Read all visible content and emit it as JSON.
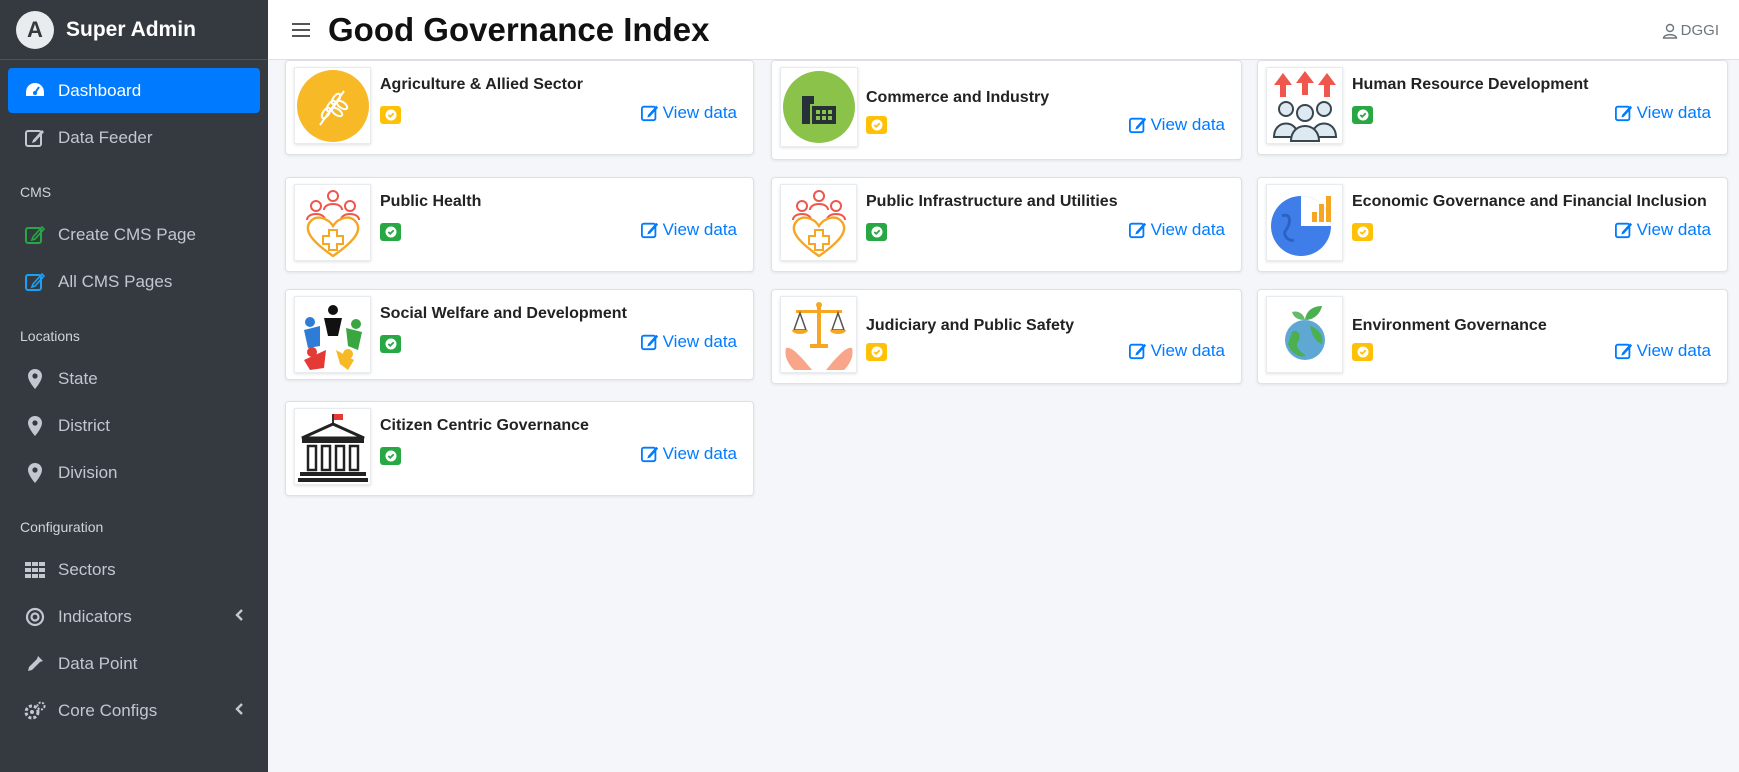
{
  "sidebar": {
    "brand": "Super Admin",
    "items": {
      "dashboard": "Dashboard",
      "data_feeder": "Data Feeder",
      "cms_header": "CMS",
      "create_cms": "Create CMS Page",
      "all_cms": "All CMS Pages",
      "locations_header": "Locations",
      "state": "State",
      "district": "District",
      "division": "Division",
      "config_header": "Configuration",
      "sectors": "Sectors",
      "indicators": "Indicators",
      "data_point": "Data Point",
      "core_configs": "Core Configs"
    }
  },
  "header": {
    "title": "Good Governance Index",
    "user": "DGGI"
  },
  "colors": {
    "accent": "#007bff",
    "sidebar": "#343a40",
    "status_green": "#28a745",
    "status_yellow": "#ffc107"
  },
  "sectors": [
    {
      "title": "Agriculture & Allied Sector",
      "status": "yellow",
      "icon": "wheat-icon",
      "link": "View data"
    },
    {
      "title": "Commerce and Industry",
      "status": "yellow",
      "icon": "factory-icon",
      "link": "View data"
    },
    {
      "title": "Human Resource Development",
      "status": "green",
      "icon": "people-growth-icon",
      "link": "View data"
    },
    {
      "title": "Public Health",
      "status": "green",
      "icon": "health-heart-icon",
      "link": "View data"
    },
    {
      "title": "Public Infrastructure and Utilities",
      "status": "green",
      "icon": "health-heart-icon",
      "link": "View data"
    },
    {
      "title": "Economic Governance and Financial Inclusion",
      "status": "yellow",
      "icon": "globe-chart-icon",
      "link": "View data"
    },
    {
      "title": "Social Welfare and Development",
      "status": "green",
      "icon": "people-circle-icon",
      "link": "View data"
    },
    {
      "title": "Judiciary and Public Safety",
      "status": "yellow",
      "icon": "scales-icon",
      "link": "View data"
    },
    {
      "title": "Environment Governance",
      "status": "yellow",
      "icon": "earth-leaf-icon",
      "link": "View data"
    },
    {
      "title": "Citizen Centric Governance",
      "status": "green",
      "icon": "government-building-icon",
      "link": "View data"
    }
  ]
}
